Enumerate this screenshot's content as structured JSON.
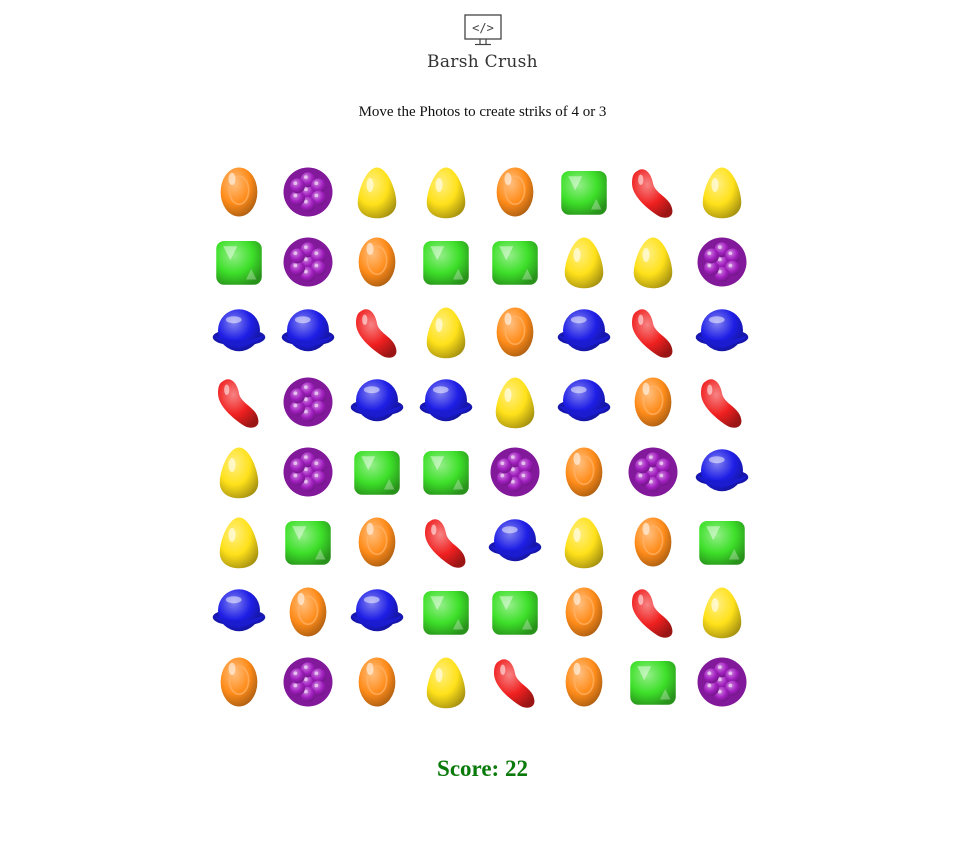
{
  "app": {
    "title": "Barsh Crush",
    "logo_icon": "code-monitor-icon",
    "logo_glyph": "</>"
  },
  "instructions": "Move the Photos to create striks of 4 or 3",
  "score": {
    "text": "Score: 22",
    "value": 22,
    "color": "#0a7a0a"
  },
  "candy_colors": {
    "orange": "#ff8c1a",
    "purple": "#a21fc0",
    "yellow": "#ffe11a",
    "red": "#f02020",
    "green": "#3ee02a",
    "blue": "#1e1ee6"
  },
  "board": {
    "rows": 8,
    "cols": 8,
    "grid": [
      [
        "orange",
        "purple",
        "yellow",
        "yellow",
        "orange",
        "green",
        "red",
        "yellow"
      ],
      [
        "green",
        "purple",
        "orange",
        "green",
        "green",
        "yellow",
        "yellow",
        "purple"
      ],
      [
        "blue",
        "blue",
        "red",
        "yellow",
        "orange",
        "blue",
        "red",
        "blue"
      ],
      [
        "red",
        "purple",
        "blue",
        "blue",
        "yellow",
        "blue",
        "orange",
        "red"
      ],
      [
        "yellow",
        "purple",
        "green",
        "green",
        "purple",
        "orange",
        "purple",
        "blue"
      ],
      [
        "yellow",
        "green",
        "orange",
        "red",
        "blue",
        "yellow",
        "orange",
        "green"
      ],
      [
        "blue",
        "orange",
        "blue",
        "green",
        "green",
        "orange",
        "red",
        "yellow"
      ],
      [
        "orange",
        "purple",
        "orange",
        "yellow",
        "red",
        "orange",
        "green",
        "purple"
      ]
    ]
  }
}
